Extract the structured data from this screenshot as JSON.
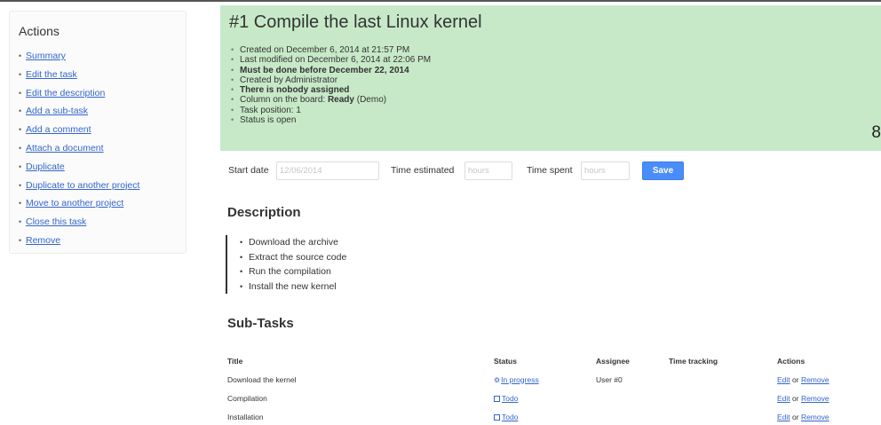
{
  "sidebar": {
    "title": "Actions",
    "items": [
      {
        "label": "Summary"
      },
      {
        "label": "Edit the task"
      },
      {
        "label": "Edit the description"
      },
      {
        "label": "Add a sub-task"
      },
      {
        "label": "Add a comment"
      },
      {
        "label": "Attach a document"
      },
      {
        "label": "Duplicate"
      },
      {
        "label": "Duplicate to another project"
      },
      {
        "label": "Move to another project"
      },
      {
        "label": "Close this task"
      },
      {
        "label": "Remove"
      }
    ]
  },
  "task": {
    "title": "#1 Compile the last Linux kernel",
    "created": "Created on December 6, 2014 at 21:57 PM",
    "modified": "Last modified on December 6, 2014 at 22:06 PM",
    "due": "Must be done before December 22, 2014",
    "created_by": "Created by Administrator",
    "assignee": "There is nobody assigned",
    "column_prefix": "Column on the board: ",
    "column_name": "Ready",
    "column_suffix": " (Demo)",
    "position": "Task position: 1",
    "status": "Status is open",
    "truncated_number": "8"
  },
  "time_form": {
    "start_label": "Start date",
    "start_value": "12/06/2014",
    "estimated_label": "Time estimated",
    "estimated_placeholder": "hours",
    "spent_label": "Time spent",
    "spent_placeholder": "hours",
    "save_label": "Save"
  },
  "description": {
    "heading": "Description",
    "items": [
      "Download the archive",
      "Extract the source code",
      "Run the compilation",
      "Install the new kernel"
    ]
  },
  "subtasks": {
    "heading": "Sub-Tasks",
    "columns": {
      "title": "Title",
      "status": "Status",
      "assignee": "Assignee",
      "time": "Time tracking",
      "actions": "Actions"
    },
    "rows": [
      {
        "title": "Download the kernel",
        "status": "In progress",
        "status_icon": "cogs-icon",
        "assignee": "User #0",
        "edit": "Edit",
        "or": " or ",
        "remove": "Remove"
      },
      {
        "title": "Compilation",
        "status": "Todo",
        "status_icon": "square-icon",
        "assignee": "",
        "edit": "Edit",
        "or": " or ",
        "remove": "Remove"
      },
      {
        "title": "Installation",
        "status": "Todo",
        "status_icon": "square-icon",
        "assignee": "",
        "edit": "Edit",
        "or": " or ",
        "remove": "Remove"
      }
    ]
  },
  "colors": {
    "summary_bg": "#c7e9c8",
    "link": "#3366cc",
    "save_button": "#4b8df8"
  }
}
